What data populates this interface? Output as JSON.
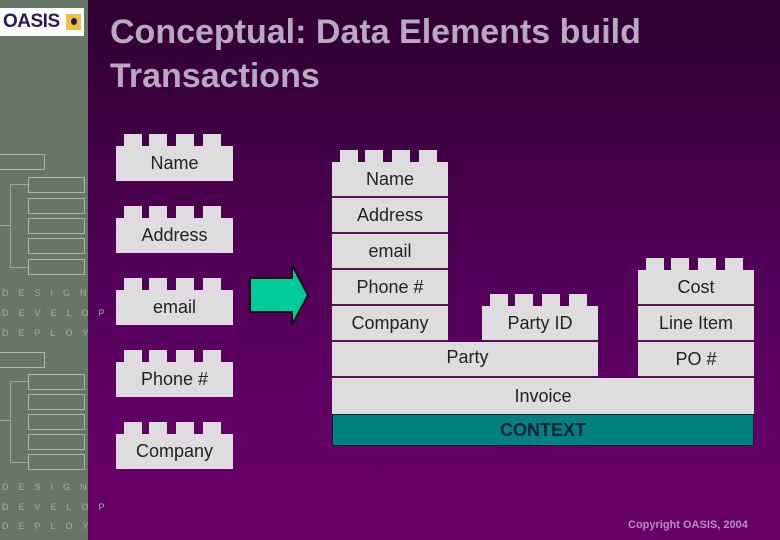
{
  "logo": {
    "text": "OASIS",
    "icon": "oasis-logo-mark-icon"
  },
  "sidebar": {
    "words": [
      "DESIGN",
      "DEVELOP",
      "DEPLOY"
    ]
  },
  "title": {
    "line1": "Conceptual: Data Elements build",
    "line2": "Transactions"
  },
  "left_elements": [
    "Name",
    "Address",
    "email",
    "Phone #",
    "Company"
  ],
  "arrow": {
    "icon": "right-arrow-icon",
    "color": "#00CC99"
  },
  "transaction": {
    "party_stack": [
      "Name",
      "Address",
      "email",
      "Phone #",
      "Company"
    ],
    "party_id": "Party ID",
    "party": "Party",
    "line_item_stack": [
      "Cost",
      "Line Item",
      "PO #"
    ],
    "invoice": "Invoice",
    "context": "CONTEXT"
  },
  "colors": {
    "brick": "#DDDDDD",
    "context": "#008080",
    "sidebar": "#667766",
    "background_top": "#2E0030",
    "background_bottom": "#660066"
  },
  "footer": {
    "copyright": "Copyright OASIS, 2004"
  }
}
